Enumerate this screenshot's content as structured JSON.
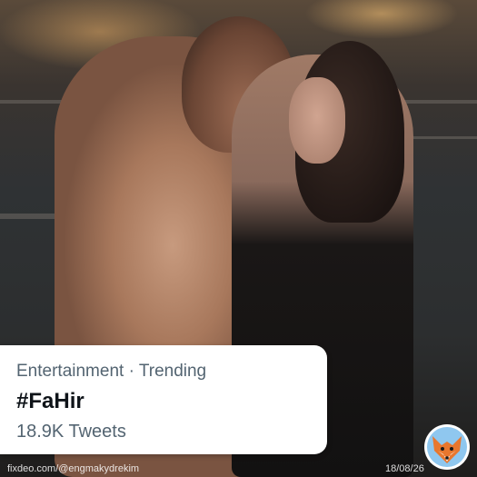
{
  "trend_card": {
    "category": "Entertainment",
    "separator": " · ",
    "status": "Trending",
    "hashtag": "#FaHir",
    "tweet_count": "18.9K Tweets"
  },
  "overlay": {
    "watermark": "fixdeo.com/@engmakydrekim",
    "date": "18/08/26",
    "logo_icon": "fox-logo-icon"
  },
  "colors": {
    "card_bg": "#ffffff",
    "primary_text": "#0f1419",
    "secondary_text": "#536471"
  }
}
